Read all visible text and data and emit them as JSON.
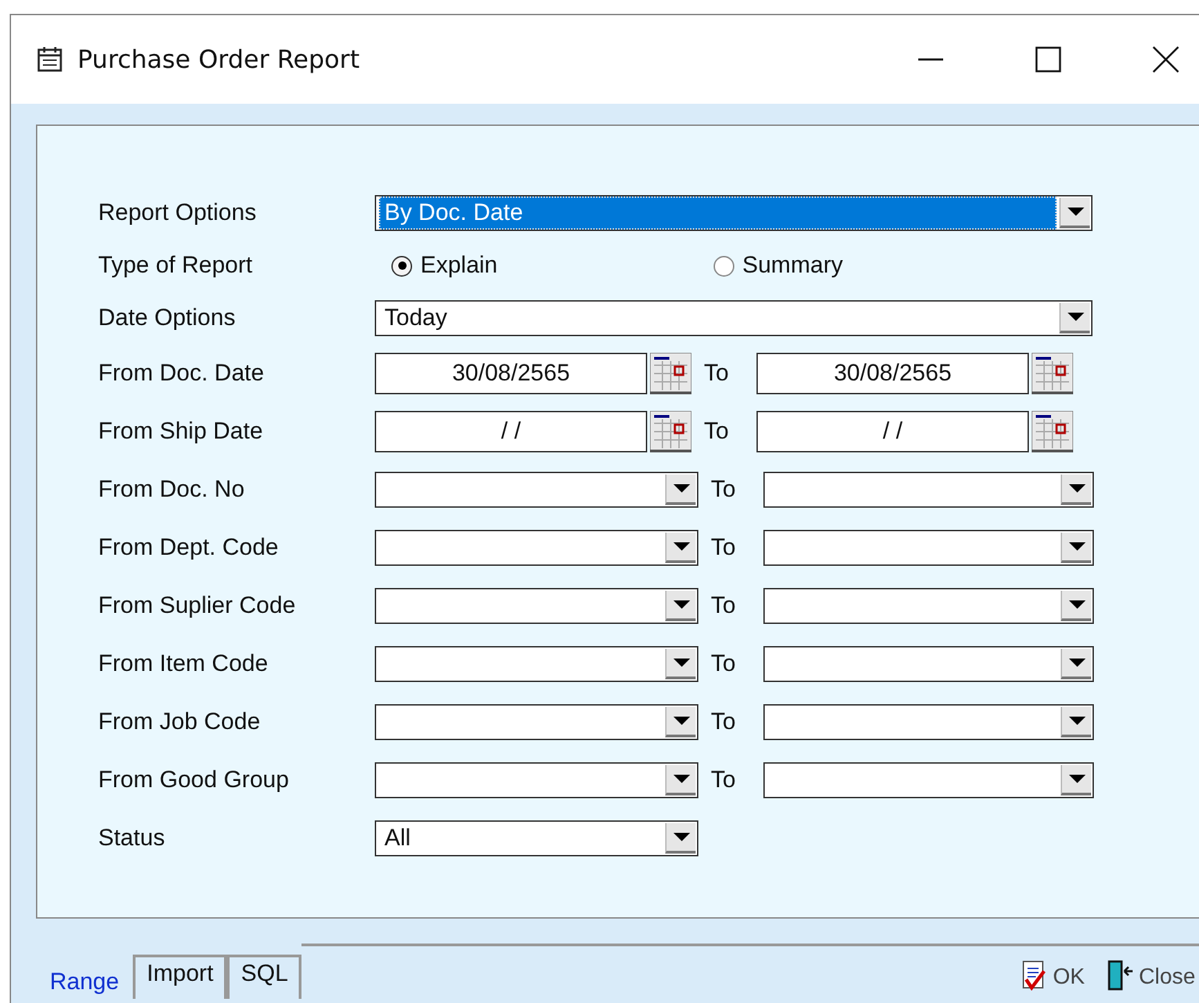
{
  "window": {
    "title": "Purchase Order Report"
  },
  "rows": [
    {
      "kind": "wide-combo",
      "label": "Report Options",
      "value": "By Doc. Date",
      "focused": true
    },
    {
      "kind": "radio",
      "label": "Type of Report",
      "options": [
        {
          "label": "Explain",
          "selected": true
        },
        {
          "label": "Summary",
          "selected": false
        }
      ]
    },
    {
      "kind": "wide-combo",
      "label": "Date Options",
      "value": "Today",
      "focused": false
    },
    {
      "kind": "date-range",
      "label": "From Doc. Date",
      "from": "30/08/2565",
      "to_label": "To",
      "to": "30/08/2565"
    },
    {
      "kind": "date-range",
      "label": "From Ship Date",
      "from": "/ /",
      "to_label": "To",
      "to": "/ /"
    },
    {
      "kind": "combo-range",
      "label": "From Doc. No",
      "to_label": "To"
    },
    {
      "kind": "combo-range",
      "label": "From Dept. Code",
      "to_label": "To"
    },
    {
      "kind": "combo-range",
      "label": "From Suplier Code",
      "to_label": "To"
    },
    {
      "kind": "combo-range",
      "label": "From Item Code",
      "to_label": "To"
    },
    {
      "kind": "combo-range",
      "label": "From Job Code",
      "to_label": "To"
    },
    {
      "kind": "combo-range",
      "label": "From Good Group",
      "to_label": "To"
    },
    {
      "kind": "combo",
      "label": "Status",
      "value": "All",
      "focused": false
    }
  ],
  "tabs": [
    {
      "label": "Range",
      "selected": true
    },
    {
      "label": "Import",
      "selected": false
    },
    {
      "label": "SQL",
      "selected": false
    }
  ],
  "buttons": [
    {
      "kind": "ok",
      "label": "OK"
    },
    {
      "kind": "close",
      "label": "Close"
    }
  ]
}
